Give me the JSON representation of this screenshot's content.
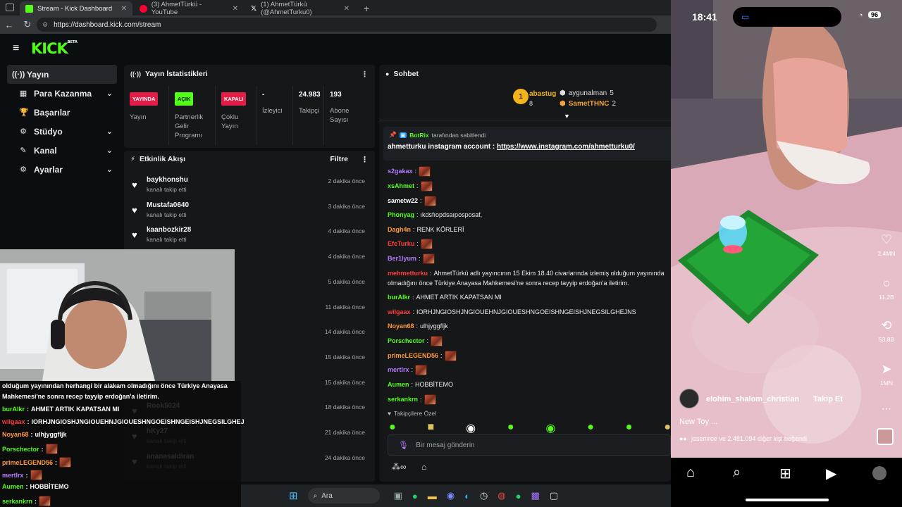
{
  "browser": {
    "tabs": [
      {
        "title": "Stream - Kick Dashboard",
        "active": true,
        "color": "#53fc18"
      },
      {
        "title": "(3) AhmetTürkü - YouTube",
        "active": false,
        "color": "#ff0033"
      },
      {
        "title": "(1) AhmetTürkü (@AhmetTurku0)",
        "active": false,
        "color": "#ffffff"
      }
    ],
    "url": "https://dashboard.kick.com/stream"
  },
  "kick": {
    "logo": "KICK",
    "logo_badge": "BETA",
    "accent": "#53fc18",
    "sidebar": [
      {
        "label": "Yayın",
        "icon": "broadcast-icon",
        "glyph": "((·))",
        "active": true,
        "chevron": false
      },
      {
        "label": "Para Kazanma",
        "icon": "money-icon",
        "glyph": "▦",
        "active": false,
        "chevron": true
      },
      {
        "label": "Başarılar",
        "icon": "trophy-icon",
        "glyph": "🏆",
        "active": false,
        "chevron": false
      },
      {
        "label": "Stüdyo",
        "icon": "studio-icon",
        "glyph": "⚙",
        "active": false,
        "chevron": true
      },
      {
        "label": "Kanal",
        "icon": "channel-icon",
        "glyph": "✎",
        "active": false,
        "chevron": true
      },
      {
        "label": "Ayarlar",
        "icon": "settings-icon",
        "glyph": "⚙",
        "active": false,
        "chevron": true
      }
    ],
    "stats": {
      "title": "Yayın İstatistikleri",
      "cells": [
        {
          "badge": "YAYINDA",
          "badge_color": "#e11d48",
          "badge_text_color": "#ffffff",
          "label": "Yayın"
        },
        {
          "badge": "AÇIK",
          "badge_color": "#53fc18",
          "badge_text_color": "#0b0e11",
          "label": "Partnerlik Gelir Programı"
        },
        {
          "badge": "KAPALI",
          "badge_color": "#e11d48",
          "badge_text_color": "#ffffff",
          "label": "Çoklu Yayın"
        },
        {
          "value": "-",
          "label": "İzleyici"
        },
        {
          "value": "24.983",
          "label": "Takipçi"
        },
        {
          "value": "193",
          "label": "Abone Sayısı"
        }
      ]
    },
    "events": {
      "title": "Etkinlik Akışı",
      "filter_label": "Filtre",
      "items": [
        {
          "name": "baykhonshu",
          "sub": "kanalı takip etti",
          "time": "2 dakika önce"
        },
        {
          "name": "Mustafa0640",
          "sub": "kanalı takip etti",
          "time": "3 dakika önce"
        },
        {
          "name": "kaanbozkir28",
          "sub": "kanalı takip etti",
          "time": "4 dakika önce"
        },
        {
          "name": "",
          "sub": "",
          "time": "4 dakika önce"
        },
        {
          "name": "",
          "sub": "",
          "time": "5 dakika önce"
        },
        {
          "name": "",
          "sub": "",
          "time": "11 dakika önce"
        },
        {
          "name": "",
          "sub": "",
          "time": "14 dakika önce"
        },
        {
          "name": "",
          "sub": "",
          "time": "15 dakika önce"
        },
        {
          "name": "",
          "sub": "",
          "time": "15 dakika önce"
        },
        {
          "name": "Rook5024",
          "sub": "",
          "time": "18 dakika önce"
        },
        {
          "name": "hKy27",
          "sub": "kanalı takip etti",
          "time": "21 dakika önce"
        },
        {
          "name": "ananasaldiran",
          "sub": "kanalı takip etti",
          "time": "24 dakika önce"
        }
      ]
    },
    "chat": {
      "title": "Sohbet",
      "leaderboard": [
        {
          "rank": "1",
          "name": "abastug",
          "count": "8"
        },
        {
          "name": "aygunalman",
          "count": "5"
        },
        {
          "name": "SametTHNC",
          "count": "2"
        }
      ],
      "pinned_by_user": "BotRix",
      "pinned_by_suffix": "tarafından sabitlendi",
      "pinned_text": "ahmetturku instagram account : ",
      "pinned_link": "https://www.instagram.com/ahmetturku0/",
      "messages": [
        {
          "user": "s2gakax",
          "color": "#b57bff",
          "text": "",
          "emote": true
        },
        {
          "user": "xsAhmet",
          "color": "#53fc18",
          "text": "",
          "emote": true
        },
        {
          "user": "sametw22",
          "color": "#ffffff",
          "text": "",
          "emote": true
        },
        {
          "user": "Phonyag",
          "color": "#53fc18",
          "text": "ıkdsfıopdsaıposposaf,",
          "emote": false
        },
        {
          "user": "Dagh4n",
          "color": "#ff9a3d",
          "text": "RENK KÖRLERİ",
          "emote": false
        },
        {
          "user": "EfeTurku",
          "color": "#ff3d3d",
          "text": "",
          "emote": true
        },
        {
          "user": "Ber1lyum",
          "color": "#b57bff",
          "text": "",
          "emote": true
        },
        {
          "user": "mehmetturku",
          "color": "#ff3d3d",
          "text": "AhmetTürkü adlı yayıncının 15 Ekim 18.40 civarlarında izlemiş olduğum yayınında",
          "emote": false
        },
        {
          "user": "",
          "color": "#ffffff",
          "text": "olmadığını önce Türkiye Anayasa Mahkemesi'ne sonra recep tayyip erdoğan'a iletirim.",
          "emote": false
        },
        {
          "user": "burAlkr",
          "color": "#53fc18",
          "text": "AHMET ARTIK KAPATSAN MI",
          "emote": false
        },
        {
          "user": "wilgaax",
          "color": "#ff3d3d",
          "text": "IORHJNGIOSHJNGIOUEHNJGIOUESHNGOEISHNGEISHJNEGSILGHEJNS",
          "emote": false
        },
        {
          "user": "Noyan68",
          "color": "#ff9a3d",
          "text": "ulhjyggfljk",
          "emote": false
        },
        {
          "user": "Porschector",
          "color": "#53fc18",
          "text": "",
          "emote": true
        },
        {
          "user": "primeLEGEND56",
          "color": "#ff9a3d",
          "text": "",
          "emote": true
        },
        {
          "user": "mertlrx",
          "color": "#b57bff",
          "text": "",
          "emote": true
        },
        {
          "user": "Aumen",
          "color": "#53fc18",
          "text": "HOBBİTEMO",
          "emote": false
        },
        {
          "user": "serkankrn",
          "color": "#53fc18",
          "text": "",
          "emote": true
        }
      ],
      "followers_only": "Takipçilere Özel",
      "input_placeholder": "Bir mesaj gönderin"
    }
  },
  "overlay": {
    "lines": [
      {
        "user": "",
        "color": "#ffffff",
        "text": "olduğum yayınından herhangi bir alakam olmadığını önce Türkiye Anayasa",
        "emote": false
      },
      {
        "user": "",
        "color": "#ffffff",
        "text": "Mahkemesi'ne sonra recep tayyip erdoğan'a iletirim.",
        "emote": false
      },
      {
        "user": "burAlkr",
        "color": "#53fc18",
        "text": "AHMET ARTIK KAPATSAN MI",
        "emote": false
      },
      {
        "user": "wilgaax",
        "color": "#ff3d3d",
        "text": "IORHJNGIOSHJNGIOUEHNJGIOUESHNGOEISHNGEISHJNEGSILGHEJ",
        "emote": false
      },
      {
        "user": "Noyan68",
        "color": "#ff9a3d",
        "text": "ulhjyggfljk",
        "emote": false
      },
      {
        "user": "Porschector",
        "color": "#53fc18",
        "text": "",
        "emote": true
      },
      {
        "user": "primeLEGEND56",
        "color": "#ff9a3d",
        "text": "",
        "emote": true
      },
      {
        "user": "mertlrx",
        "color": "#b57bff",
        "text": "",
        "emote": true
      },
      {
        "user": "Aumen",
        "color": "#53fc18",
        "text": "HOBBİTEMO",
        "emote": false
      },
      {
        "user": "serkankrn",
        "color": "#53fc18",
        "text": "",
        "emote": true
      }
    ]
  },
  "taskbar": {
    "search_placeholder": "Ara"
  },
  "phone": {
    "time": "18:41",
    "battery": "96",
    "counts": {
      "likes": "2,4MN",
      "comments": "11,2B",
      "reposts": "53,8B",
      "shares": "1MN"
    },
    "username": "elohim_shalom_christian",
    "follow_label": "Takip Et",
    "caption": "New Toy ...",
    "liked_by": "josemree ve 2.481.094 diğer kişi beğendi"
  }
}
